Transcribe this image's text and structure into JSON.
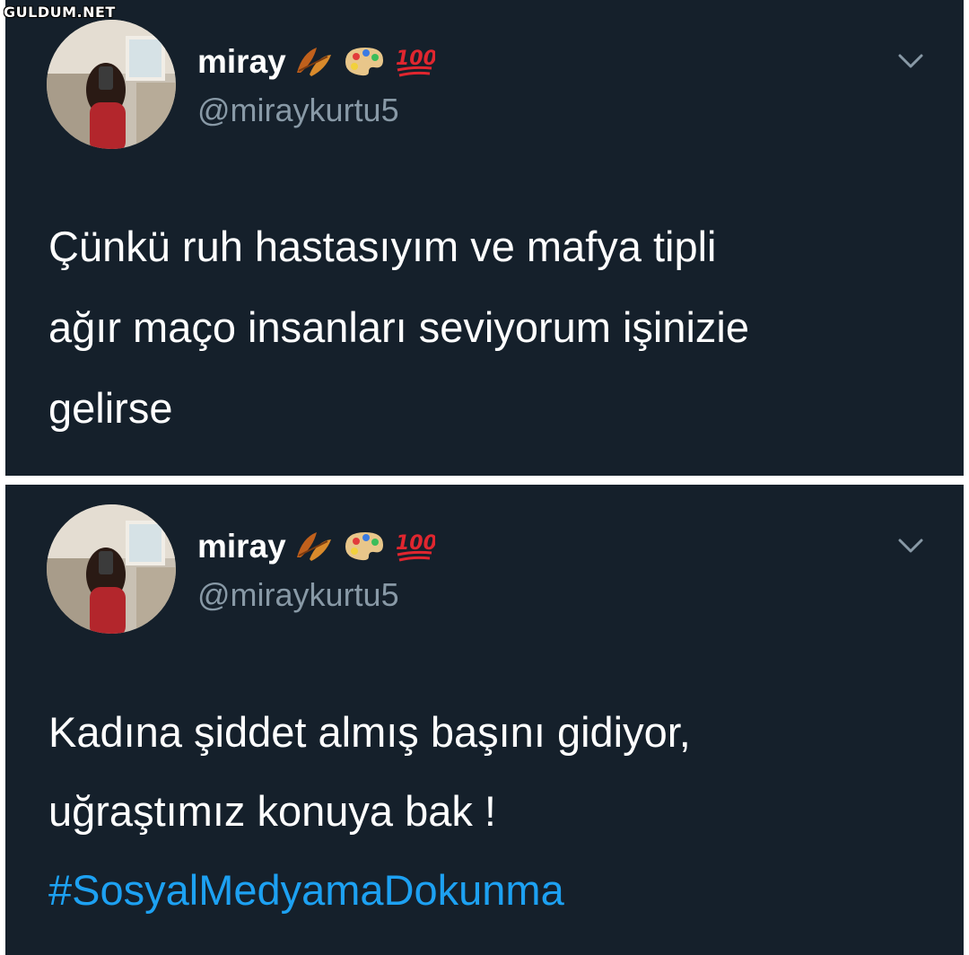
{
  "watermark": "GULDUM.NET",
  "tweets": [
    {
      "display_name": "miray",
      "handle": "@miraykurtu5",
      "name_emojis": [
        "fallen-leaf-icon",
        "artist-palette-icon",
        "hundred-points-icon"
      ],
      "text_lines": [
        "Çünkü ruh hastasıyım ve mafya tipli",
        "ağır maço insanları seviyorum işinizie",
        "gelirse"
      ],
      "hashtag": ""
    },
    {
      "display_name": "miray",
      "handle": "@miraykurtu5",
      "name_emojis": [
        "fallen-leaf-icon",
        "artist-palette-icon",
        "hundred-points-icon"
      ],
      "text_lines": [
        "Kadına şiddet almış başını gidiyor,",
        "uğraştımız konuya bak !"
      ],
      "hashtag": "#SosyalMedyamaDokunma"
    }
  ],
  "colors": {
    "tweet_background": "#15202b",
    "text": "#ffffff",
    "secondary_text": "#8899a6",
    "hashtag": "#1da1f2",
    "hundred_points": "#e0262f"
  }
}
